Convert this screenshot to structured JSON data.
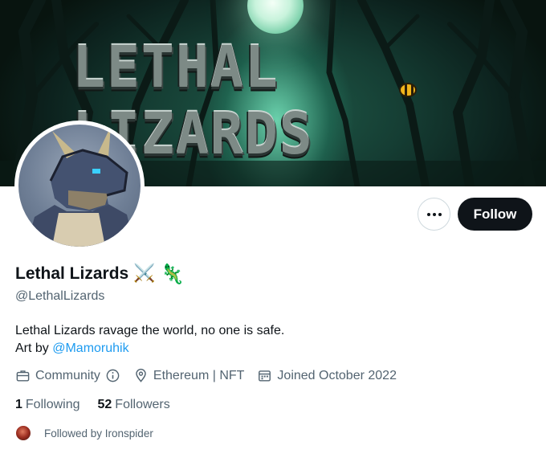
{
  "banner": {
    "logo_text": "LETHAL LIZARDS"
  },
  "actions": {
    "more_icon": "more-horizontal-icon",
    "follow_label": "Follow"
  },
  "profile": {
    "display_name": "Lethal Lizards",
    "name_emojis": [
      "⚔️",
      "🦎"
    ],
    "handle": "@LethalLizards",
    "bio_line1": "Lethal Lizards ravage the world, no one is safe.",
    "bio_line2_prefix": "Art by ",
    "bio_mention": "@Mamoruhik"
  },
  "meta": {
    "category": "Community",
    "category_icon": "briefcase-icon",
    "info_icon": "info-circle-icon",
    "location": "Ethereum | NFT",
    "location_icon": "location-pin-icon",
    "joined": "Joined October 2022",
    "joined_icon": "calendar-icon"
  },
  "stats": {
    "following_count": "1",
    "following_label": "Following",
    "followers_count": "52",
    "followers_label": "Followers"
  },
  "followed_by": {
    "text": "Followed by Ironspider"
  },
  "colors": {
    "text_primary": "#0f1419",
    "text_secondary": "#536471",
    "link": "#1d9bf0",
    "follow_button_bg": "#0f1419"
  }
}
